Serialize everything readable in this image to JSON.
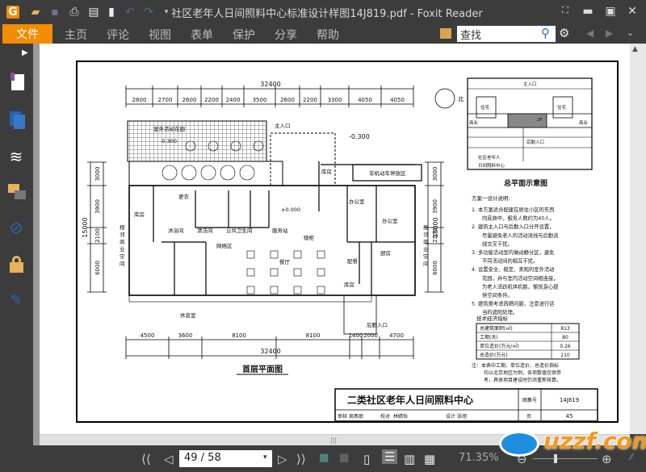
{
  "app": {
    "title": "社区老年人日间照料中心标准设计样图14J819.pdf - Foxit Reader"
  },
  "ribbon": {
    "file": "文件",
    "tabs": [
      "主页",
      "评论",
      "视图",
      "表单",
      "保护",
      "分享",
      "帮助"
    ],
    "search_placeholder": "查找"
  },
  "status": {
    "page": "49 / 58",
    "zoom": "71.35%"
  },
  "plan": {
    "top_total": "32400",
    "top_segments": [
      "2800",
      "2700",
      "2600",
      "2200",
      "2400",
      "3500",
      "2600",
      "2200",
      "3300",
      "4050",
      "4050"
    ],
    "bottom_segments": [
      "4500",
      "3600",
      "8100",
      "8100",
      "1400",
      "2000",
      "4700"
    ],
    "bottom_total": "32400",
    "left_dims": [
      "3000",
      "3900",
      "2100",
      "6000"
    ],
    "side_total": "15000",
    "north": "北",
    "rooms": {
      "garden": "室外活动花园",
      "garden_level": "-0.300",
      "main_entry": "主入口",
      "level_right": "-0.300",
      "bike": "非机动车停放区",
      "storage1": "库房",
      "storage2": "库房",
      "storage3": "库房",
      "change": "更衣",
      "zero": "±0.000",
      "office1": "办公室",
      "office2": "办公室",
      "bath": "沐浴间",
      "clean": "清洁间",
      "wc": "公共卫生间",
      "service": "服务站",
      "cabinet": "矮柜",
      "net": "网络区",
      "dining": "餐厅",
      "pantry": "配餐",
      "kitchen": "厨房",
      "rest": "休息室",
      "back_entry": "后勤入口",
      "neighbor_l": "相邻商业空间",
      "neighbor_r": "相邻商业空间",
      "down": "下",
      "up": "上"
    },
    "title": "首层平面图"
  },
  "site": {
    "main_entry": "主入口",
    "house": "住宅",
    "commerce": "商业",
    "floor": "2F",
    "back_entry": "后勤入口",
    "label1": "社区老年人",
    "label2": "日间照料中心",
    "title": "总平面示意图"
  },
  "notes": {
    "heading": "方案一设计说明:",
    "items": [
      "1. 本方案适合配建在居住小区的东西",
      "向底商中，服务人数约为40人。",
      "2. 建筑主入口与后勤入口分开设置，",
      "尽量避免老人的活动流线与后勤流",
      "线交叉干扰。",
      "3. 多功能活动室内做动静分区，避免",
      "不同活动间的相互干扰。",
      "4. 设置安全、稳定、美观的室外活动",
      "花园，并与室内活动空间相连接，",
      "为老人活跃机体机能，愉悦身心提",
      "供空间条件。",
      "5. 建筑需考虑西晒问题，注意进行适",
      "当的遮阳处理。"
    ]
  },
  "tech": {
    "heading": "技术经济指标",
    "rows": [
      [
        "总建筑面积(㎡)",
        "813"
      ],
      [
        "工期(天)",
        "80"
      ],
      [
        "单位造价(万元/㎡)",
        "0.26"
      ],
      [
        "总造价(万元)",
        "210"
      ]
    ],
    "note": [
      "注：本表中工期、单位造价、总造价指标",
      "均以北京地区为例，各项数值仅供参",
      "考，具体项目建设时仍须重新核算。"
    ]
  },
  "titleblock": {
    "name": "二类社区老年人日间照料中心",
    "atlas_label": "图集号",
    "atlas": "14J819",
    "page_label": "页",
    "page": "45",
    "roles": [
      "审核",
      "周燕珉",
      "校对",
      "林婧怡",
      "设计",
      "张旭"
    ]
  },
  "watermark": "uzzf.com",
  "colors": {
    "accent": "#f28c00",
    "chrome": "#3c3c3c"
  }
}
